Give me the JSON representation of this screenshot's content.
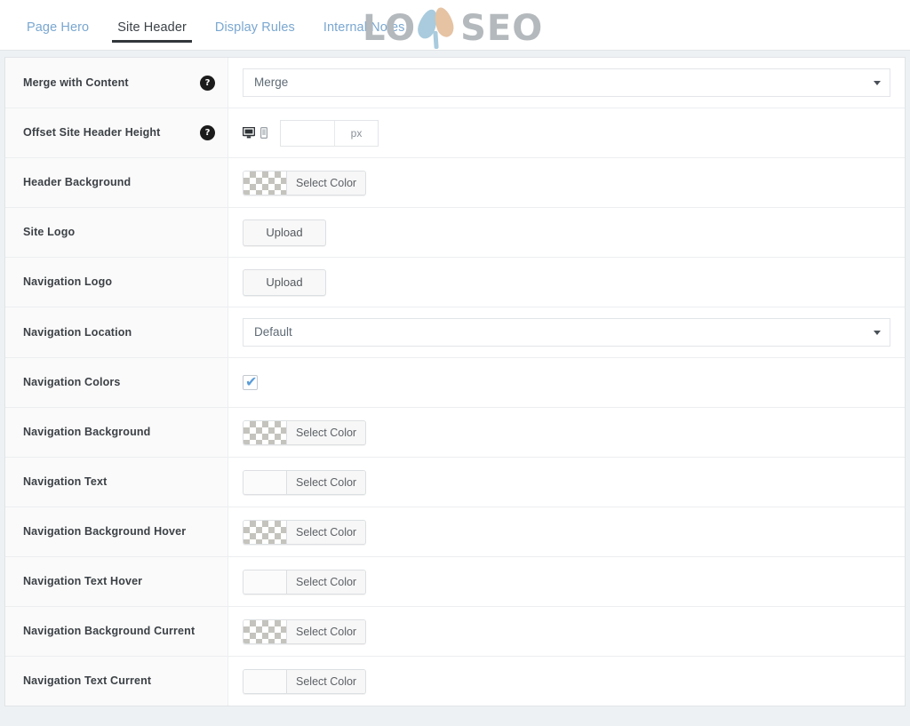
{
  "tabs": [
    {
      "label": "Page Hero",
      "active": false
    },
    {
      "label": "Site Header",
      "active": true
    },
    {
      "label": "Display Rules",
      "active": false
    },
    {
      "label": "Internal Notes",
      "active": false
    }
  ],
  "logo": {
    "text_left": "LO",
    "text_right": "SEO",
    "color_text": "#b4b9bd",
    "color_petal_left": "#a9cbdd",
    "color_petal_right": "#e5c3a3"
  },
  "rows": [
    {
      "label": "Merge with Content",
      "help": "?",
      "control": "select",
      "value": "Merge"
    },
    {
      "label": "Offset Site Header Height",
      "help": "?",
      "control": "offset",
      "value": "",
      "placeholder": "",
      "unit": "px",
      "devices": [
        "desktop-icon",
        "mobile-icon"
      ]
    },
    {
      "label": "Header Background",
      "control": "color",
      "swatch": "transparent",
      "button_label": "Select Color"
    },
    {
      "label": "Site Logo",
      "control": "upload",
      "button_label": "Upload"
    },
    {
      "label": "Navigation Logo",
      "control": "upload",
      "button_label": "Upload"
    },
    {
      "label": "Navigation Location",
      "control": "select",
      "value": "Default"
    },
    {
      "label": "Navigation Colors",
      "control": "checkbox",
      "checked": true
    },
    {
      "label": "Navigation Background",
      "control": "color",
      "swatch": "transparent",
      "button_label": "Select Color"
    },
    {
      "label": "Navigation Text",
      "control": "color",
      "swatch": "blank",
      "button_label": "Select Color"
    },
    {
      "label": "Navigation Background Hover",
      "control": "color",
      "swatch": "transparent",
      "button_label": "Select Color"
    },
    {
      "label": "Navigation Text Hover",
      "control": "color",
      "swatch": "blank",
      "button_label": "Select Color"
    },
    {
      "label": "Navigation Background Current",
      "control": "color",
      "swatch": "transparent",
      "button_label": "Select Color"
    },
    {
      "label": "Navigation Text Current",
      "control": "color",
      "swatch": "blank",
      "button_label": "Select Color"
    }
  ],
  "colors": {
    "tab_inactive": "#7aa7d0",
    "tab_active": "#3c4247",
    "label_text": "#3c4146",
    "panel_bg": "#ffffff",
    "label_col_bg": "#fafafa",
    "page_bg": "#eef1f4",
    "checkbox_tick": "#5b9dd9"
  }
}
